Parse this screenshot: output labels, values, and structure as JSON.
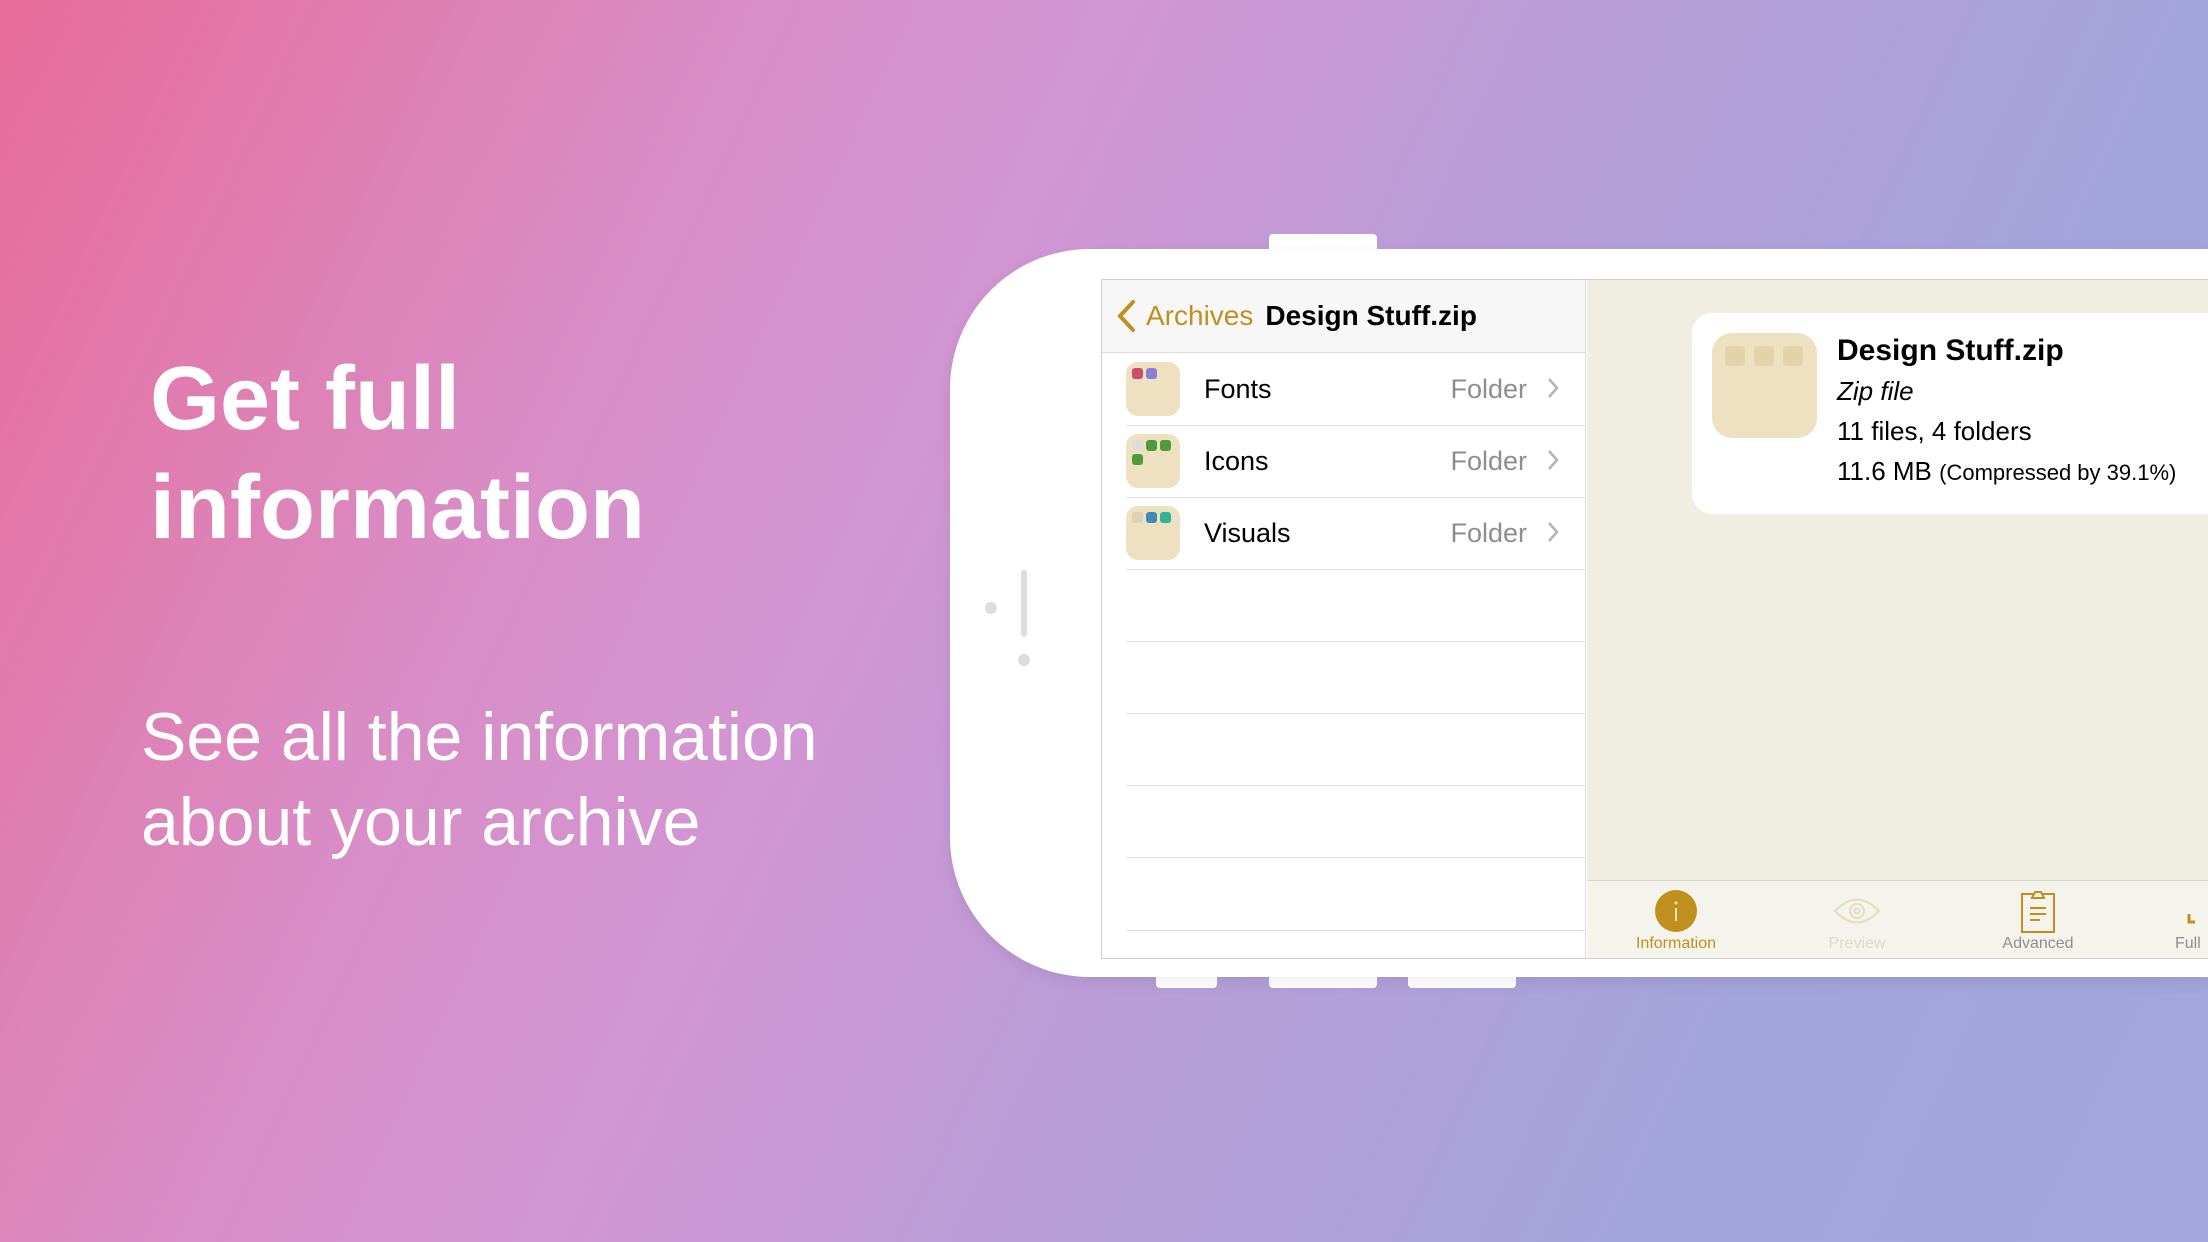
{
  "marketing": {
    "headline": "Get full information",
    "subtitle": "See all the information about your archive"
  },
  "nav": {
    "back_label": "Archives",
    "title": "Design Stuff.zip"
  },
  "list": [
    {
      "name": "Fonts",
      "kind": "Folder"
    },
    {
      "name": "Icons",
      "kind": "Folder"
    },
    {
      "name": "Visuals",
      "kind": "Folder"
    }
  ],
  "info": {
    "name": "Design Stuff.zip",
    "type": "Zip file",
    "contents": "11 files, 4 folders",
    "size": "11.6 MB",
    "compression": "(Compressed by 39.1%)"
  },
  "tabs": [
    {
      "label": "Information",
      "icon": "info-icon",
      "state": "active"
    },
    {
      "label": "Preview",
      "icon": "eye-icon",
      "state": "disabled"
    },
    {
      "label": "Advanced",
      "icon": "clipboard-icon",
      "state": "normal"
    },
    {
      "label": "Full",
      "icon": "download-icon",
      "state": "normal"
    }
  ],
  "colors": {
    "accent": "#c0901f",
    "panel": "#efeee0",
    "folder": "#ede1c1"
  }
}
